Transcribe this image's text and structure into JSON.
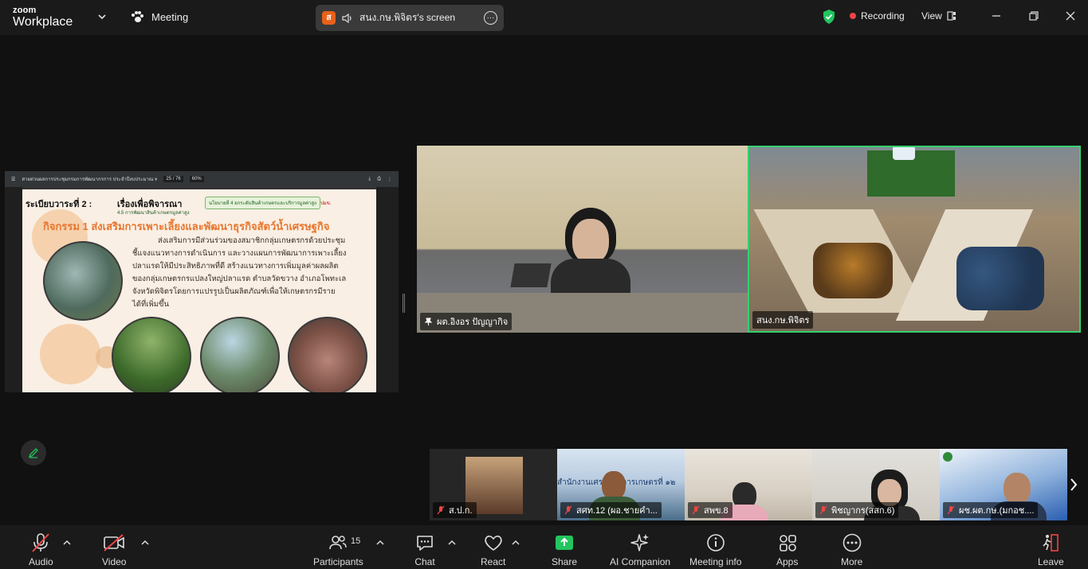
{
  "topbar": {
    "logo_line1": "zoom",
    "logo_line2": "Workplace",
    "meeting_label": "Meeting",
    "share_avatar": "ส",
    "share_label": "สนง.กษ.พิจิตร's screen",
    "recording_label": "Recording",
    "view_label": "View"
  },
  "slide": {
    "toolbar_title": "สายด่วนผลการประชุมกรมการพัฒนากรการ ประจำปีงบประมาณ พ.ศ. 2568 ร...",
    "page_indicator": "25 / 76",
    "zoom_level": "60%",
    "agenda_label": "ระเบียบวาระที่ 2 :",
    "agenda_topic": "เรื่องเพื่อพิจารณา",
    "policy_tag": "นโยบายที่ 4 ยกระดับสินค้าเกษตรและบริการมูลค่าสูง",
    "corner_tag": "ปมข.",
    "subtitle": "4.5 การพัฒนาสินค้าเกษตรมูลค่าสูง",
    "activity_title": "กิจกรรม 1 ส่งเสริมการเพาะเลี้ยงและพัฒนาธุรกิจสัตว์น้ำเศรษฐกิจ",
    "body_lines": [
      "ส่งเสริมการมีส่วนร่วมของสมาชิกกลุ่มเกษตรกรด้วยประชุม",
      "ชี้แจงแนวทางการดำเนินการ และวางแผนการพัฒนาการเพาะเลี้ยง",
      "ปลาแรดให้มีประสิทธิภาพที่ดี สร้างแนวทางการเพิ่มมูลค่าผลผลิต",
      "ของกลุ่มเกษตรกรแปลงใหญ่ปลาแรด ตำบลวัดขวาง อำเภอโพทะเล",
      "จังหวัดพิจิตรโดยการแปรรูปเป็นผลิตภัณฑ์เพื่อให้เกษตรกรมีราย",
      "ได้ที่เพิ่มขึ้น"
    ]
  },
  "main_tiles": [
    {
      "name": "ผต.อิงอร ปัญญากิจ",
      "pinned": true
    },
    {
      "name": "สนง.กษ.พิจิตร",
      "active_speaker": true
    }
  ],
  "strip_tiles": [
    {
      "name": "ส.ป.ก.",
      "muted": true
    },
    {
      "name": "สศท.12 (ผอ.ชายคำ...",
      "muted": true,
      "banner": "สำนักงานเศรษฐกิจการเกษตรที่ ๑๒"
    },
    {
      "name": "สพข.8",
      "muted": true
    },
    {
      "name": "พิชญากร(สสก.6)",
      "muted": true
    },
    {
      "name": "ผช.ผต.กษ.(มกอช....",
      "muted": true
    }
  ],
  "toolbar": {
    "audio": "Audio",
    "video": "Video",
    "participants": "Participants",
    "participants_count": "15",
    "chat": "Chat",
    "react": "React",
    "share": "Share",
    "ai_companion": "AI Companion",
    "meeting_info": "Meeting info",
    "apps": "Apps",
    "more": "More",
    "leave": "Leave"
  },
  "colors": {
    "background": "#111111",
    "active_speaker_border": "#34d06d",
    "share_green": "#22c55e",
    "recording_red": "#ef4444",
    "leave_red": "#ef4444"
  }
}
